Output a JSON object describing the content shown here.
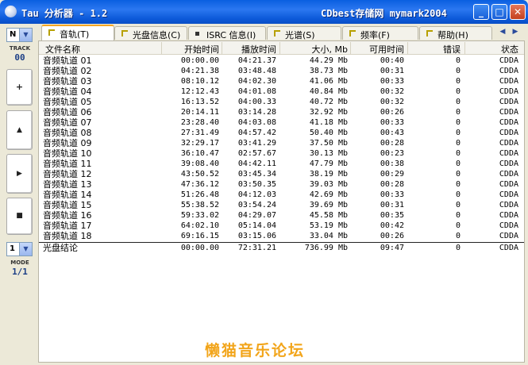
{
  "window": {
    "title": "Tau 分析器 - 1.2",
    "right_title": "CDbest存储网 mymark2004"
  },
  "left": {
    "drive_select": "N",
    "track_label": "TRACK",
    "track_value": "00",
    "mode_select": "1",
    "mode_label": "MODE",
    "mode_value": "1/1",
    "buttons": [
      "+",
      "▲",
      "▶",
      "■"
    ]
  },
  "tabs": [
    {
      "label": "音轨(T)",
      "active": true
    },
    {
      "label": "光盘信息(C)",
      "active": false
    },
    {
      "label": "ISRC 信息(I)",
      "active": false
    },
    {
      "label": "光谱(S)",
      "active": false
    },
    {
      "label": "频率(F)",
      "active": false
    },
    {
      "label": "帮助(H)",
      "active": false
    }
  ],
  "table": {
    "columns": [
      "文件名称",
      "开始时间",
      "播放时间",
      "大小, Mb",
      "可用时间",
      "错误",
      "状态"
    ],
    "rows": [
      [
        "音频轨道 01",
        "00:00.00",
        "04:21.37",
        "44.29 Mb",
        "00:40",
        "0",
        "CDDA"
      ],
      [
        "音频轨道 02",
        "04:21.38",
        "03:48.48",
        "38.73 Mb",
        "00:31",
        "0",
        "CDDA"
      ],
      [
        "音频轨道 03",
        "08:10.12",
        "04:02.30",
        "41.06 Mb",
        "00:33",
        "0",
        "CDDA"
      ],
      [
        "音频轨道 04",
        "12:12.43",
        "04:01.08",
        "40.84 Mb",
        "00:32",
        "0",
        "CDDA"
      ],
      [
        "音频轨道 05",
        "16:13.52",
        "04:00.33",
        "40.72 Mb",
        "00:32",
        "0",
        "CDDA"
      ],
      [
        "音频轨道 06",
        "20:14.11",
        "03:14.28",
        "32.92 Mb",
        "00:26",
        "0",
        "CDDA"
      ],
      [
        "音频轨道 07",
        "23:28.40",
        "04:03.08",
        "41.18 Mb",
        "00:33",
        "0",
        "CDDA"
      ],
      [
        "音频轨道 08",
        "27:31.49",
        "04:57.42",
        "50.40 Mb",
        "00:43",
        "0",
        "CDDA"
      ],
      [
        "音频轨道 09",
        "32:29.17",
        "03:41.29",
        "37.50 Mb",
        "00:28",
        "0",
        "CDDA"
      ],
      [
        "音频轨道 10",
        "36:10.47",
        "02:57.67",
        "30.13 Mb",
        "00:23",
        "0",
        "CDDA"
      ],
      [
        "音频轨道 11",
        "39:08.40",
        "04:42.11",
        "47.79 Mb",
        "00:38",
        "0",
        "CDDA"
      ],
      [
        "音频轨道 12",
        "43:50.52",
        "03:45.34",
        "38.19 Mb",
        "00:29",
        "0",
        "CDDA"
      ],
      [
        "音频轨道 13",
        "47:36.12",
        "03:50.35",
        "39.03 Mb",
        "00:28",
        "0",
        "CDDA"
      ],
      [
        "音频轨道 14",
        "51:26.48",
        "04:12.03",
        "42.69 Mb",
        "00:33",
        "0",
        "CDDA"
      ],
      [
        "音频轨道 15",
        "55:38.52",
        "03:54.24",
        "39.69 Mb",
        "00:31",
        "0",
        "CDDA"
      ],
      [
        "音频轨道 16",
        "59:33.02",
        "04:29.07",
        "45.58 Mb",
        "00:35",
        "0",
        "CDDA"
      ],
      [
        "音频轨道 17",
        "64:02.10",
        "05:14.04",
        "53.19 Mb",
        "00:42",
        "0",
        "CDDA"
      ],
      [
        "音频轨道 18",
        "69:16.15",
        "03:15.06",
        "33.04 Mb",
        "00:26",
        "0",
        "CDDA"
      ]
    ],
    "total": [
      "光盘结论",
      "00:00.00",
      "72:31.21",
      "736.99 Mb",
      "09:47",
      "0",
      "CDDA"
    ]
  },
  "watermark": "懒猫音乐论坛"
}
